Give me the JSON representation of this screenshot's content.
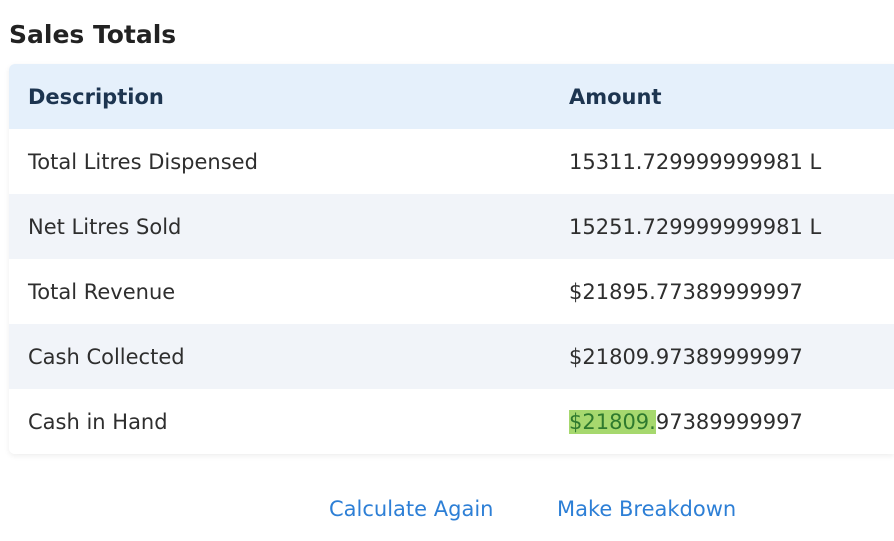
{
  "title": "Sales Totals",
  "table": {
    "headers": [
      "Description",
      "Amount"
    ],
    "rows": [
      {
        "description": "Total Litres Dispensed",
        "amount": "15311.729999999981 L"
      },
      {
        "description": "Net Litres Sold",
        "amount": "15251.729999999981 L"
      },
      {
        "description": "Total Revenue",
        "amount": "$21895.77389999997"
      },
      {
        "description": "Cash Collected",
        "amount": "$21809.97389999997"
      },
      {
        "description": "Cash in Hand",
        "amount_highlighted": "$21809.",
        "amount_rest": "97389999997"
      }
    ]
  },
  "actions": {
    "calculate_again": "Calculate Again",
    "make_breakdown": "Make Breakdown"
  },
  "colors": {
    "header_bg": "#e5f0fb",
    "stripe_bg": "#f1f4f9",
    "link": "#2d7fd6",
    "highlight": "#a6d86e"
  }
}
